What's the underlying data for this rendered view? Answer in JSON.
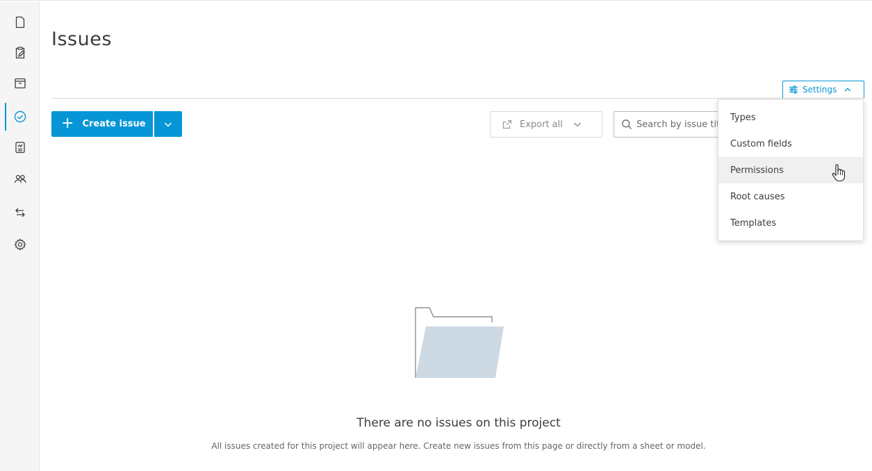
{
  "page": {
    "title": "Issues"
  },
  "sidebar": {
    "items": [
      {
        "icon": "file-icon",
        "active": false
      },
      {
        "icon": "clipboard-edit-icon",
        "active": false
      },
      {
        "icon": "archive-box-icon",
        "active": false
      },
      {
        "icon": "check-circle-icon",
        "active": true
      },
      {
        "icon": "report-icon",
        "active": false
      },
      {
        "icon": "people-icon",
        "active": false
      },
      {
        "icon": "transfer-arrows-icon",
        "active": false
      },
      {
        "icon": "gear-icon",
        "active": false
      }
    ]
  },
  "toolbar": {
    "settings_label": "Settings",
    "create_label": "Create issue",
    "export_label": "Export all",
    "search_placeholder": "Search by issue title"
  },
  "settings_menu": {
    "items": [
      "Types",
      "Custom fields",
      "Permissions",
      "Root causes",
      "Templates"
    ],
    "hovered": "Permissions"
  },
  "empty_state": {
    "title": "There are no issues on this project",
    "description": "All issues created for this project will appear here. Create new issues from this page or directly from a sheet or model."
  },
  "colors": {
    "accent": "#0696d7",
    "folder": "#cdd9e3"
  }
}
